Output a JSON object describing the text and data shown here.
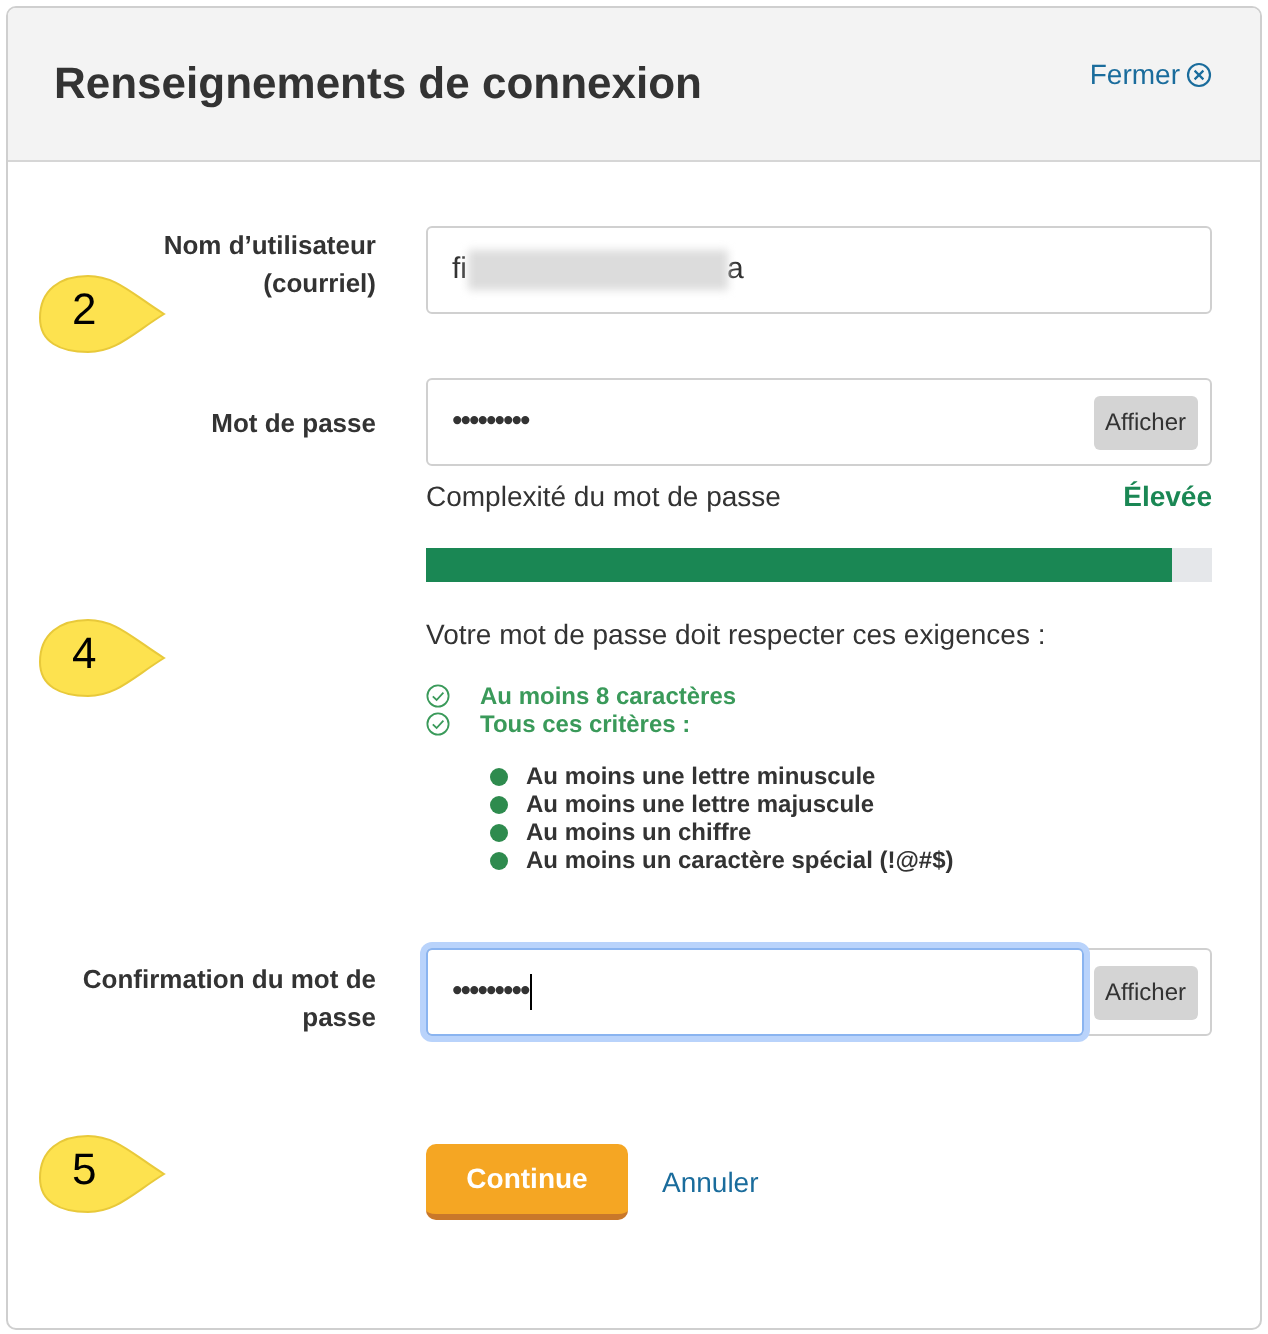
{
  "header": {
    "title": "Renseignements de connexion",
    "close_link": "Fermer"
  },
  "username": {
    "label": "Nom d’utilisateur (courriel)",
    "value_start": "fi",
    "value_end": "a",
    "redacted": true,
    "callout": "2"
  },
  "password": {
    "label": "Mot de passe",
    "value": "•••••••••",
    "button": "Afficher",
    "focused": false,
    "strength": {
      "label": "Complexité du mot de passe",
      "rating": "Élevée",
      "level": 0.95
    }
  },
  "requirements": {
    "intro": "Votre mot de passe doit respecter ces exigences :",
    "callout": "4",
    "checks": [
      {
        "text": "Au moins 8 caractères",
        "met": true
      },
      {
        "text": "Tous ces critères :",
        "met": true
      }
    ],
    "criteria": [
      {
        "text": "Au moins une lettre minuscule",
        "met": true
      },
      {
        "text": "Au moins une lettre majuscule",
        "met": true
      },
      {
        "text": "Au moins un chiffre",
        "met": true
      },
      {
        "text": "Au moins un caractère spécial (!@#$)",
        "met": true
      }
    ]
  },
  "confirm": {
    "label": "Confirmation du mot de passe",
    "value": "•••••••••",
    "button": "Afficher",
    "focused": true
  },
  "actions": {
    "primary": "Continue",
    "cancel": "Annuler",
    "callout": "5"
  }
}
